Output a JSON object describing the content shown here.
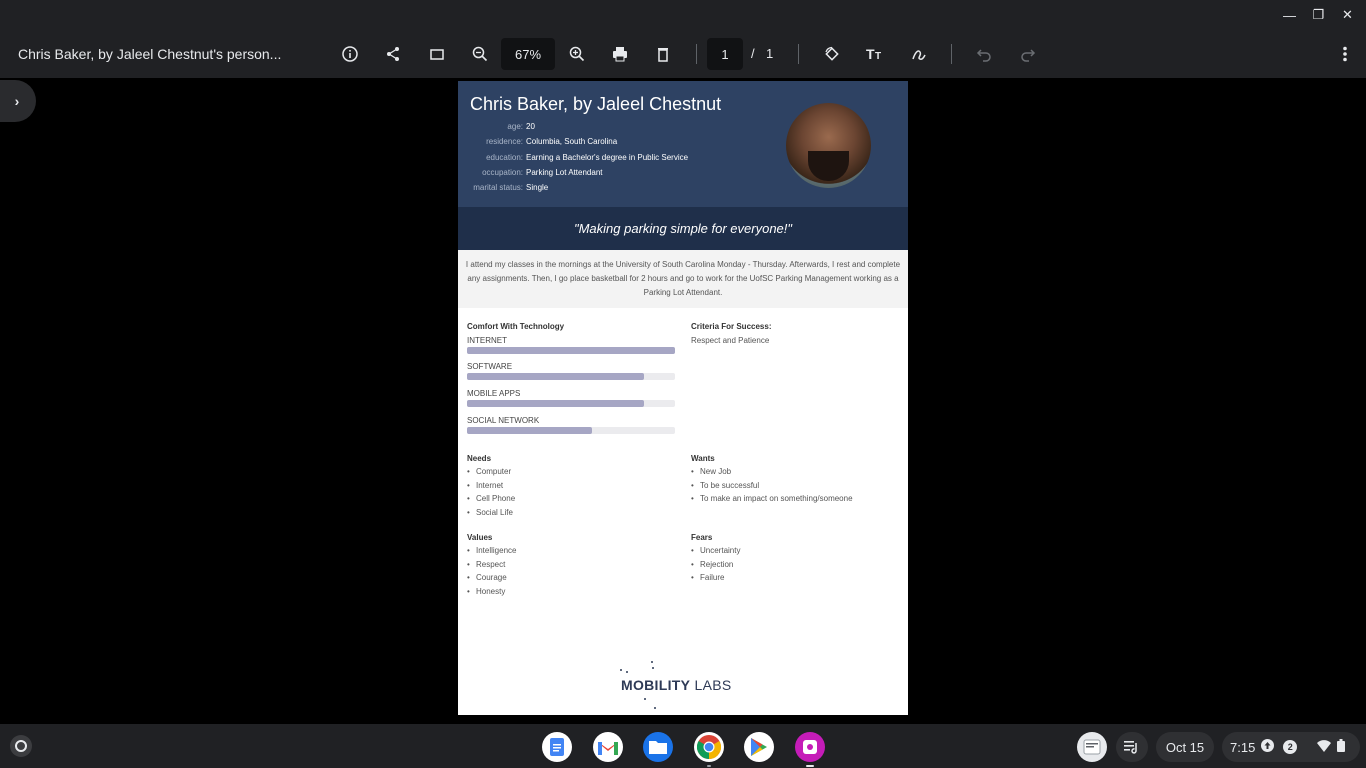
{
  "window": {
    "minimize_icon": "minimize-icon",
    "maximize_icon": "restore-icon",
    "close_icon": "close-icon"
  },
  "toolbar": {
    "title": "Chris Baker, by Jaleel Chestnut's person...",
    "zoom": "67%",
    "page_current": "1",
    "page_sep": "/",
    "page_total": "1",
    "icons": [
      "info-icon",
      "share-icon",
      "fit-page-icon",
      "zoom-out-icon",
      "zoom-in-icon",
      "print-icon",
      "delete-icon",
      "rotate-icon",
      "text-icon",
      "draw-icon",
      "undo-icon",
      "redo-icon",
      "more-icon"
    ]
  },
  "persona": {
    "name": "Chris Baker, by Jaleel Chestnut",
    "fields": [
      {
        "label": "age:",
        "value": "20"
      },
      {
        "label": "residence:",
        "value": "Columbia, South Carolina"
      },
      {
        "label": "education:",
        "value": "Earning a Bachelor's degree in Public Service"
      },
      {
        "label": "occupation:",
        "value": "Parking Lot Attendant"
      },
      {
        "label": "marital status:",
        "value": "Single"
      }
    ],
    "quote": "\"Making parking simple for everyone!\"",
    "bio": "I attend my classes in the mornings at the University of South Carolina Monday - Thursday. Afterwards, I rest and complete any assignments. Then, I go place basketball for 2 hours and go to work for the UofSC Parking Management working as a Parking Lot Attendant.",
    "comfort": {
      "heading": "Comfort With Technology",
      "items": [
        {
          "label": "INTERNET",
          "level": 1.0
        },
        {
          "label": "SOFTWARE",
          "level": 0.85
        },
        {
          "label": "MOBILE APPS",
          "level": 0.85
        },
        {
          "label": "SOCIAL NETWORK",
          "level": 0.6
        }
      ]
    },
    "criteria": {
      "heading": "Criteria For Success:",
      "text": "Respect and Patience"
    },
    "needs": {
      "heading": "Needs",
      "items": [
        "Computer",
        "Internet",
        "Cell Phone",
        "Social Life"
      ]
    },
    "wants": {
      "heading": "Wants",
      "items": [
        "New Job",
        "To be successful",
        "To make an impact on something/someone"
      ]
    },
    "values": {
      "heading": "Values",
      "items": [
        "Intelligence",
        "Respect",
        "Courage",
        "Honesty"
      ]
    },
    "fears": {
      "heading": "Fears",
      "items": [
        "Uncertainty",
        "Rejection",
        "Failure"
      ]
    },
    "logo": {
      "part1": "MOBILITY",
      "part2": " LABS"
    }
  },
  "shelf": {
    "apps": [
      "docs-icon",
      "gmail-icon",
      "files-icon",
      "chrome-icon",
      "play-store-icon",
      "screencast-icon"
    ],
    "date": "Oct 15",
    "time": "7:15",
    "notifications": "2"
  }
}
